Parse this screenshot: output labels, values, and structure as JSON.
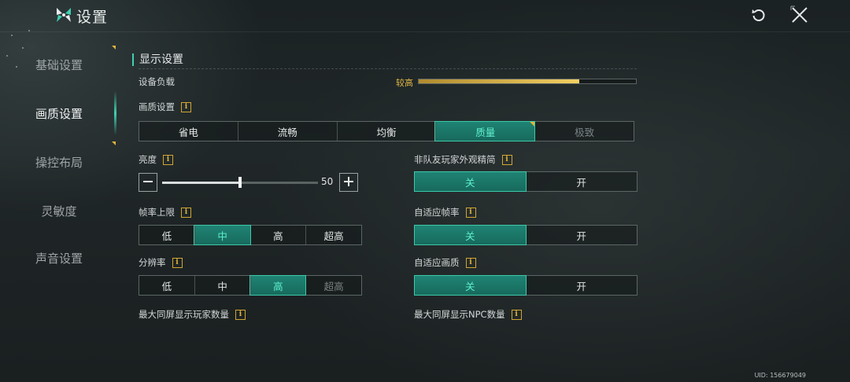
{
  "header": {
    "title": "设置",
    "logo_icon": "brand-logo-icon",
    "reset_icon": "reset-icon",
    "close_icon": "close-icon"
  },
  "sidebar": {
    "items": [
      {
        "label": "基础设置",
        "active": false
      },
      {
        "label": "画质设置",
        "active": true
      },
      {
        "label": "操控布局",
        "active": false
      },
      {
        "label": "灵敏度",
        "active": false
      },
      {
        "label": "声音设置",
        "active": false
      }
    ]
  },
  "display": {
    "section_title": "显示设置",
    "device_load": {
      "label": "设备负载",
      "value_text": "较高",
      "level": 0.74
    },
    "quality": {
      "label": "画质设置",
      "options": [
        "省电",
        "流畅",
        "均衡",
        "质量",
        "极致"
      ],
      "selected": "质量"
    },
    "brightness": {
      "label": "亮度",
      "value": 50,
      "min": 0,
      "max": 100
    },
    "frame_limit": {
      "label": "帧率上限",
      "options": [
        "低",
        "中",
        "高",
        "超高"
      ],
      "selected": "中"
    },
    "resolution": {
      "label": "分辨率",
      "options": [
        "低",
        "中",
        "高",
        "超高"
      ],
      "selected": "高"
    },
    "max_players": {
      "label": "最大同屏显示玩家数量"
    },
    "simplify_players": {
      "label": "非队友玩家外观精简",
      "options": [
        "关",
        "开"
      ],
      "selected": "关"
    },
    "adaptive_fps": {
      "label": "自适应帧率",
      "options": [
        "关",
        "开"
      ],
      "selected": "关"
    },
    "adaptive_quality": {
      "label": "自适应画质",
      "options": [
        "关",
        "开"
      ],
      "selected": "关"
    },
    "max_npc": {
      "label": "最大同屏显示NPC数量"
    },
    "info_glyph": "i"
  },
  "footer": {
    "uid": "UID: 156679049"
  },
  "colors": {
    "accent": "#3fd1b3",
    "selected_bg": "#1a7565",
    "gold": "#e0b53a"
  }
}
